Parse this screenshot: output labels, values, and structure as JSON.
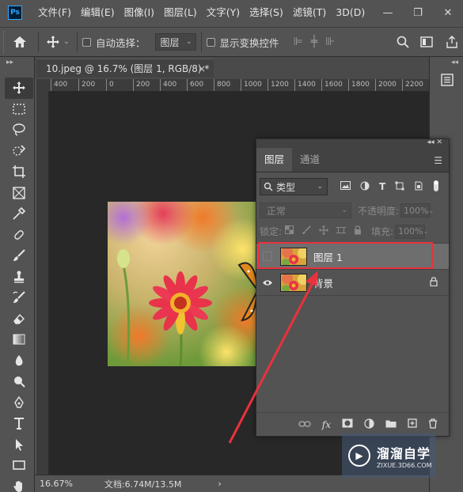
{
  "app": {
    "logo": "Ps"
  },
  "menu": [
    "文件(F)",
    "编辑(E)",
    "图像(I)",
    "图层(L)",
    "文字(Y)",
    "选择(S)",
    "滤镜(T)",
    "3D(D)"
  ],
  "window_controls": {
    "minimize": "—",
    "restore": "❐",
    "close": "✕"
  },
  "options": {
    "auto_select_label": "自动选择：",
    "auto_select_value": "图层",
    "show_transform_label": "显示变换控件"
  },
  "document": {
    "tab_title": "10.jpeg @ 16.7% (图层 1, RGB/8) *",
    "close": "×"
  },
  "ruler": {
    "h_ticks": [
      "400",
      "200",
      "0",
      "200",
      "400",
      "600",
      "800",
      "1000",
      "1200",
      "1400",
      "1600",
      "1800",
      "2000",
      "2200"
    ]
  },
  "status": {
    "zoom": "16.67%",
    "doc_info": "文档:6.74M/13.5M",
    "arrow": "›"
  },
  "layers_panel": {
    "collapse": "◂◂ ✕",
    "tabs": [
      "图层",
      "通道"
    ],
    "filter_label": "类型",
    "blend_mode": "正常",
    "opacity_label": "不透明度:",
    "opacity_value": "100%",
    "lock_label": "锁定:",
    "fill_label": "填充:",
    "fill_value": "100%",
    "layers": [
      {
        "name": "图层 1",
        "selected": true,
        "visible": false,
        "locked": false
      },
      {
        "name": "背景",
        "selected": false,
        "visible": true,
        "locked": true
      }
    ]
  },
  "colors": {
    "highlight": "#e8323c",
    "arrow": "#e8323c",
    "accent": "#31a8ff"
  },
  "watermark": {
    "title": "溜溜自学",
    "subtitle": "ZIXUE.3D66.COM"
  }
}
